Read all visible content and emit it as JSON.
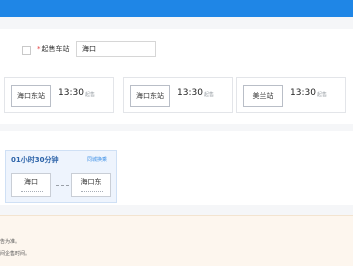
{
  "colors": {
    "accent": "#1f86e6",
    "required": "#e34040",
    "link": "#3a8ee6",
    "notice_bg": "#fdf6ee"
  },
  "form": {
    "required_marker": "*",
    "departure_station_label": "起售车站",
    "departure_station_value": "海口"
  },
  "stations": [
    {
      "name": "海口东站",
      "time": "13:30",
      "tag": "起售"
    },
    {
      "name": "海口东站",
      "time": "13:30",
      "tag": "起售"
    },
    {
      "name": "美兰站",
      "time": "13:30",
      "tag": "起售"
    }
  ],
  "route": {
    "duration": "01小时30分钟",
    "link_label": "同城换乘",
    "from": "海口",
    "to": "海口东"
  },
  "notice": {
    "line1": "告为准。",
    "line2": "间企售时间。"
  }
}
